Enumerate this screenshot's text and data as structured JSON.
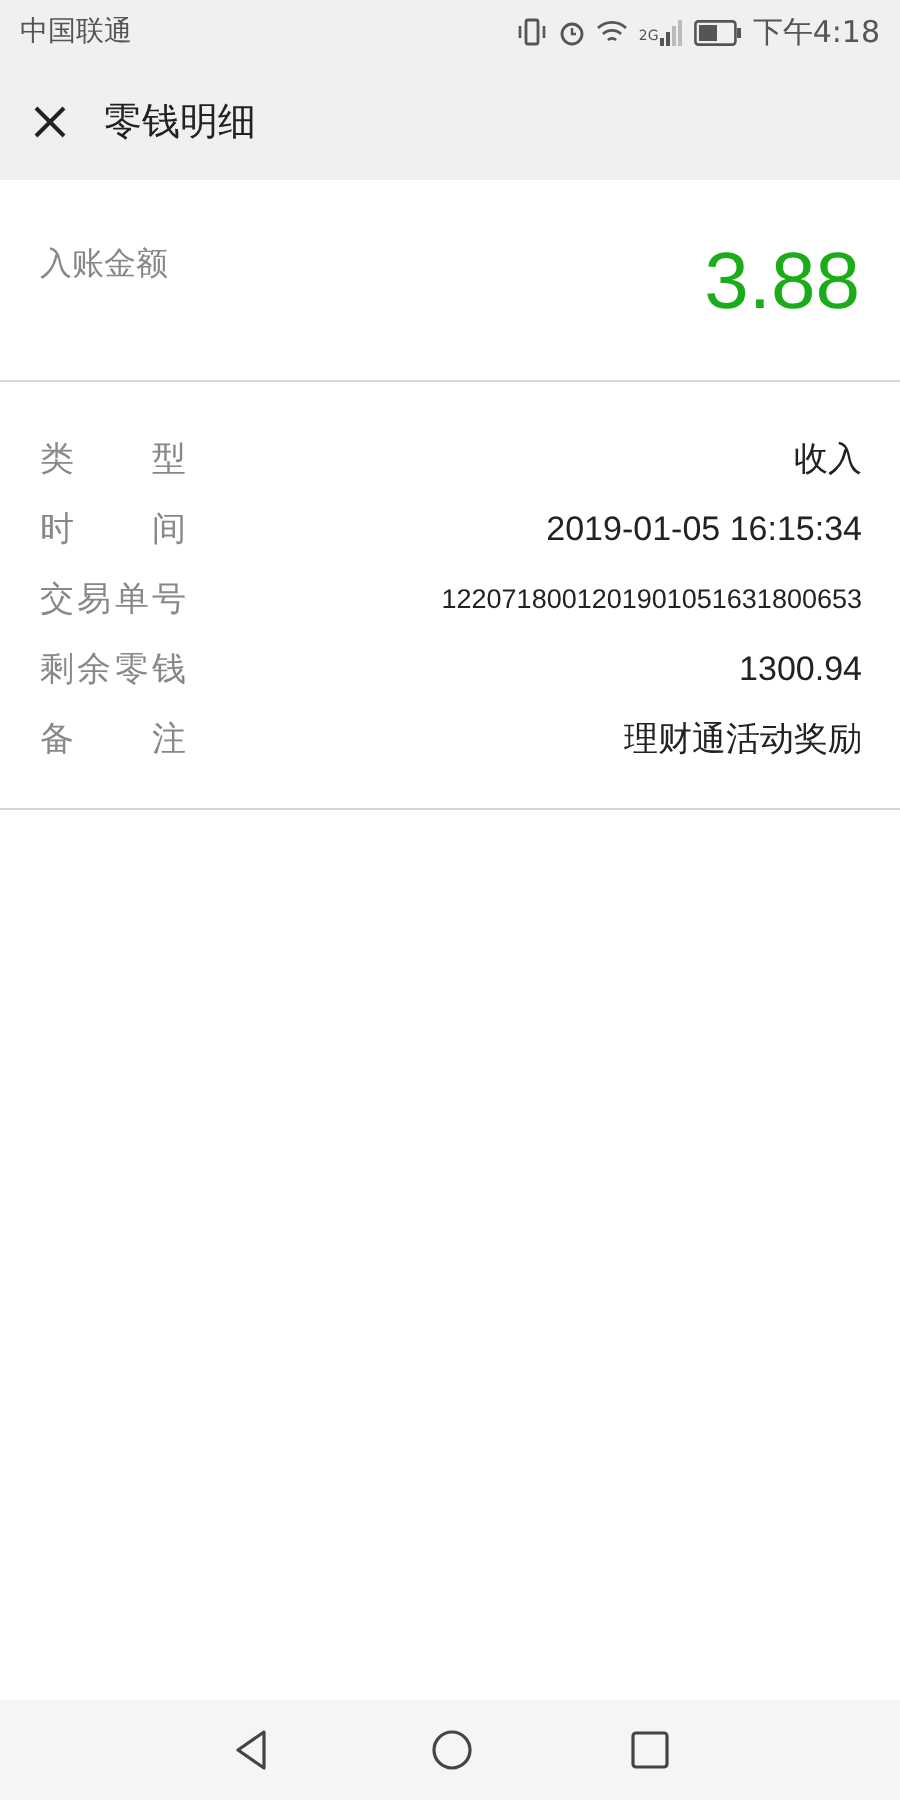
{
  "status_bar": {
    "carrier": "中国联通",
    "network": "2G",
    "time": "下午4:18"
  },
  "header": {
    "title": "零钱明细"
  },
  "amount": {
    "label": "入账金额",
    "value": "3.88"
  },
  "details": [
    {
      "label": "类 型",
      "value": "收入"
    },
    {
      "label": "时 间",
      "value": "2019-01-05 16:15:34"
    },
    {
      "label": "交易单号",
      "value": "1220718001201901051631800653",
      "kind": "small"
    },
    {
      "label": "剩余零钱",
      "value": "1300.94"
    },
    {
      "label": "备 注",
      "value": "理财通活动奖励"
    }
  ]
}
